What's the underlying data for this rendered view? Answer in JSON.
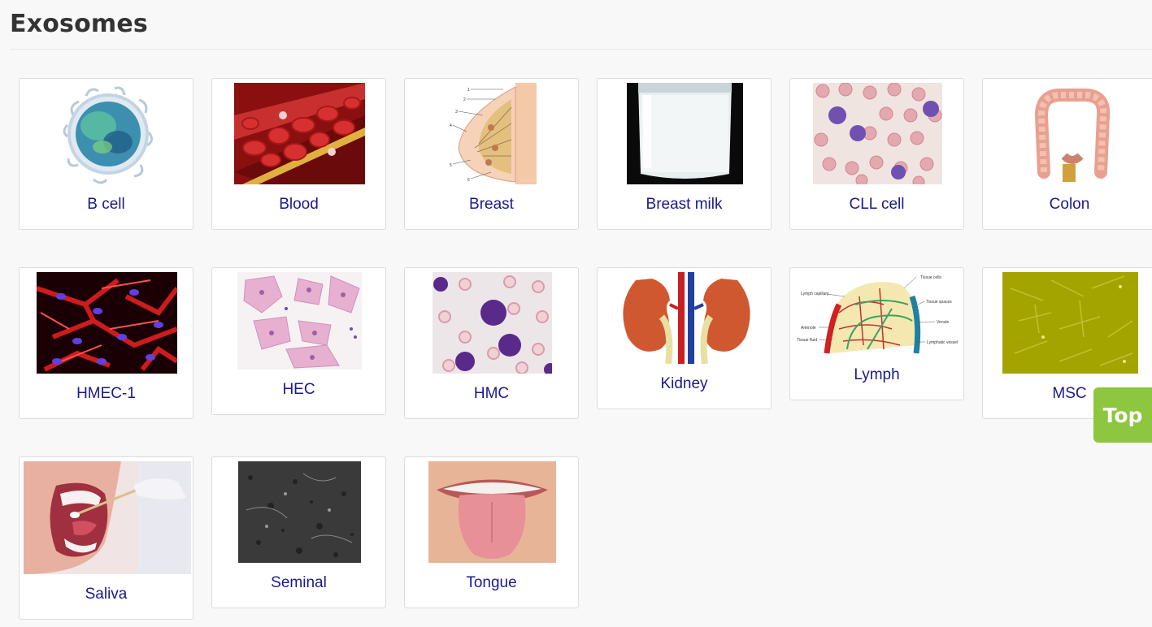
{
  "page": {
    "title": "Exosomes"
  },
  "samples": [
    {
      "label": "B cell",
      "icon": "b-cell-image"
    },
    {
      "label": "Blood",
      "icon": "blood-vessel-image"
    },
    {
      "label": "Breast",
      "icon": "breast-anatomy-image"
    },
    {
      "label": "Breast milk",
      "icon": "milk-glass-image"
    },
    {
      "label": "CLL cell",
      "icon": "cll-smear-image"
    },
    {
      "label": "Colon",
      "icon": "colon-anatomy-image"
    },
    {
      "label": "HMEC-1",
      "icon": "hmec-cells-image"
    },
    {
      "label": "HEC",
      "icon": "hec-cells-image"
    },
    {
      "label": "HMC",
      "icon": "hmc-smear-image"
    },
    {
      "label": "Kidney",
      "icon": "kidney-anatomy-image"
    },
    {
      "label": "Lymph",
      "icon": "lymph-diagram-image"
    },
    {
      "label": "MSC",
      "icon": "msc-culture-image"
    },
    {
      "label": "Saliva",
      "icon": "saliva-swab-image"
    },
    {
      "label": "Seminal",
      "icon": "seminal-sem-image"
    },
    {
      "label": "Tongue",
      "icon": "tongue-image"
    }
  ],
  "lymph_diagram_labels": [
    "Tissue cells",
    "Lymph capillary",
    "Tissue spaces",
    "Venule",
    "Arteriole",
    "Tissue fluid",
    "Lymphatic vessel"
  ],
  "breast_diagram_numbers": [
    "1",
    "2",
    "3",
    "4",
    "5",
    "6"
  ],
  "top_button": {
    "label": "Top"
  },
  "colors": {
    "label": "#1a1a8c",
    "top_button": "#8dc63f",
    "title": "#333333"
  }
}
